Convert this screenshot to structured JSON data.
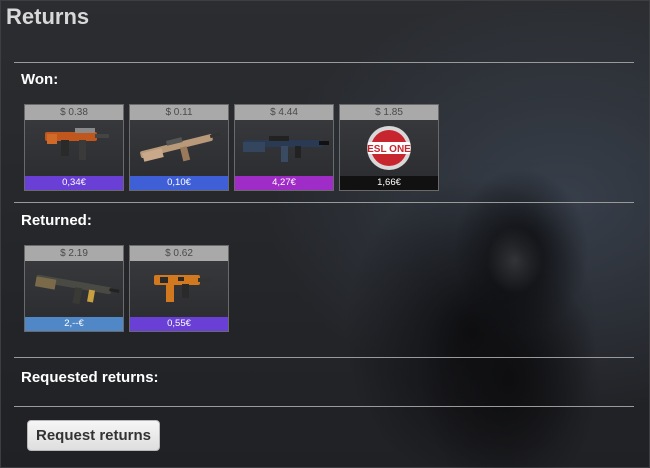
{
  "title": "Returns",
  "sections": {
    "won_label": "Won:",
    "returned_label": "Returned:",
    "requested_label": "Requested returns:"
  },
  "won_items": [
    {
      "price": "$ 0.38",
      "value": "0,34€",
      "rarity_color": "#6a3fd6",
      "icon": "smg-weapon-icon"
    },
    {
      "price": "$ 0.11",
      "value": "0,10€",
      "rarity_color": "#3f5fd6",
      "icon": "rifle-weapon-icon"
    },
    {
      "price": "$ 4.44",
      "value": "4,27€",
      "rarity_color": "#a02cc8",
      "icon": "rifle-weapon-icon"
    },
    {
      "price": "$ 1.85",
      "value": "1,66€",
      "rarity_color": "#111111",
      "icon": "esl-one-sticker-icon",
      "sticker_text": "ESL ONE"
    }
  ],
  "returned_items": [
    {
      "price": "$ 2.19",
      "value": "2,--€",
      "rarity_color": "#4f87c7",
      "icon": "rifle-weapon-icon"
    },
    {
      "price": "$ 0.62",
      "value": "0,55€",
      "rarity_color": "#6a3fd6",
      "icon": "smg-weapon-icon"
    }
  ],
  "request_button_label": "Request returns"
}
